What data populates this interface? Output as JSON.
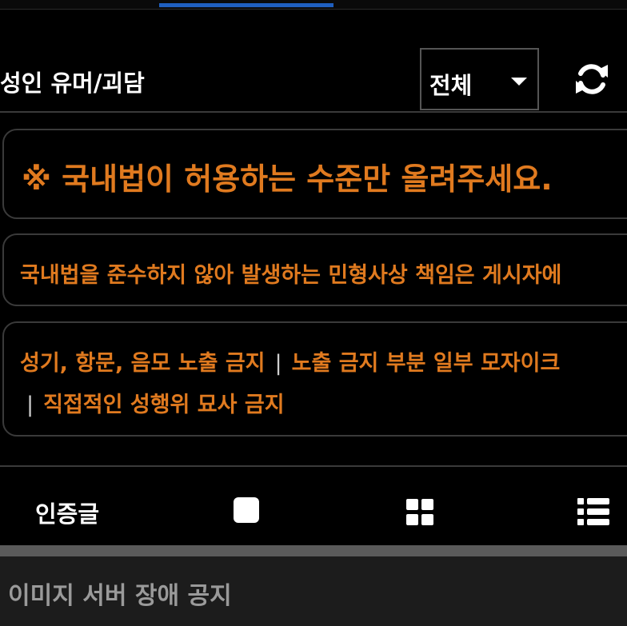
{
  "header": {
    "board_title": "성인 유머/괴담",
    "filter_selected": "전체",
    "refresh_icon": "refresh-icon"
  },
  "notices": {
    "warning": "※ 국내법이 허용하는 수준만 올려주세요.",
    "liability": "국내법을 준수하지 않아 발생하는 민형사상 책임은 게시자에",
    "rules_line1_a": "성기, 항문, 음모 노출 금지",
    "rules_sep": "|",
    "rules_line1_b": "노출 금지 부분 일부 모자이크",
    "rules_line2": "직접적인 성행위 묘사 금지"
  },
  "tabbar": {
    "cert_tab_label": "인증글",
    "icons": [
      "single-view-icon",
      "grid-view-icon",
      "list-view-icon"
    ]
  },
  "post": {
    "title": "이미지 서버 장애 공지"
  },
  "colors": {
    "accent_orange": "#e07a1f",
    "indicator_blue": "#1f5fbf"
  }
}
